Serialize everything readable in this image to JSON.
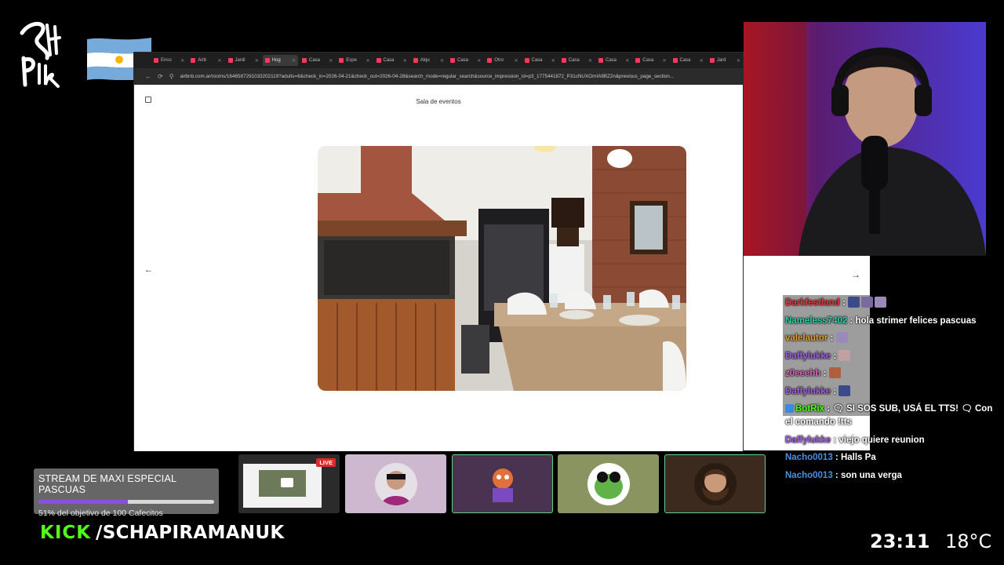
{
  "overlay": {
    "logo_text": "Schapira",
    "flag": "argentina-flag"
  },
  "browser": {
    "tabs": [
      {
        "label": "Enco"
      },
      {
        "label": "Airb"
      },
      {
        "label": "Jardi"
      },
      {
        "label": "Hog",
        "active": true
      },
      {
        "label": "Casa"
      },
      {
        "label": "Espe"
      },
      {
        "label": "Casa"
      },
      {
        "label": "Alqu"
      },
      {
        "label": "Casa"
      },
      {
        "label": "Otro"
      },
      {
        "label": "Casa"
      },
      {
        "label": "Casa"
      },
      {
        "label": "Casa"
      },
      {
        "label": "Casa"
      },
      {
        "label": "Casa"
      },
      {
        "label": "Jard"
      }
    ],
    "url": "airbnb.com.ar/rooms/1646587291033202119?adults=6&check_in=2026-04-21&check_out=2026-04-28&search_mode=regular_search&source_impression_id=p3_1775441872_P31cNUXOmIA9BZ2n&previous_page_section...",
    "photo_title": "Sala de eventos",
    "back_icon": "arrow-left-icon",
    "next_icon": "arrow-right-icon"
  },
  "chat": {
    "messages": [
      {
        "user": "Darkfestland",
        "color": "#e23a3a",
        "text": "",
        "emotes": 3
      },
      {
        "user": "Nameless7402",
        "color": "#2fd0a0",
        "text": "hola strimer felices pascuas",
        "emotes": 0
      },
      {
        "user": "valelautor",
        "color": "#e0a030",
        "text": "",
        "emotes": 1
      },
      {
        "user": "Daffylukke",
        "color": "#a060e0",
        "text": "",
        "emotes": 1
      },
      {
        "user": "z0eeehh",
        "color": "#e060c0",
        "text": "",
        "emotes": 1
      },
      {
        "user": "Daffylukke",
        "color": "#a060e0",
        "text": "",
        "emotes": 1
      },
      {
        "user": "BotRix",
        "color": "#53fc18",
        "text": "🗨 SI SOS SUB, USÁ EL TTS! 🗨 Con el comando !tts",
        "emotes": 0
      },
      {
        "user": "Daffylukke",
        "color": "#a060e0",
        "text": "viejo quiere reunion",
        "emotes": 0
      },
      {
        "user": "Nacho0013",
        "color": "#4a8fe0",
        "text": "Halls Pa",
        "emotes": 0
      },
      {
        "user": "Nacho0013",
        "color": "#4a8fe0",
        "text": "son una verga",
        "emotes": 0
      }
    ]
  },
  "goal": {
    "title": "STREAM DE MAXI ESPECIAL PASCUAS",
    "subtitle": "51% del objetivo de 100 Cafecitos",
    "progress": 0.51
  },
  "thumbnails": [
    {
      "kind": "screen",
      "live_label": "LIVE"
    },
    {
      "kind": "avatar"
    },
    {
      "kind": "avatar"
    },
    {
      "kind": "avatar"
    },
    {
      "kind": "avatar"
    }
  ],
  "footer": {
    "platform": "KICK",
    "handle": "/SCHAPIRAMANUK",
    "time": "23:11",
    "temperature": "18°C"
  },
  "colors": {
    "kick_green": "#53fc18",
    "goal_fill": "#8a4fe0",
    "live_red": "#e02a2a"
  }
}
